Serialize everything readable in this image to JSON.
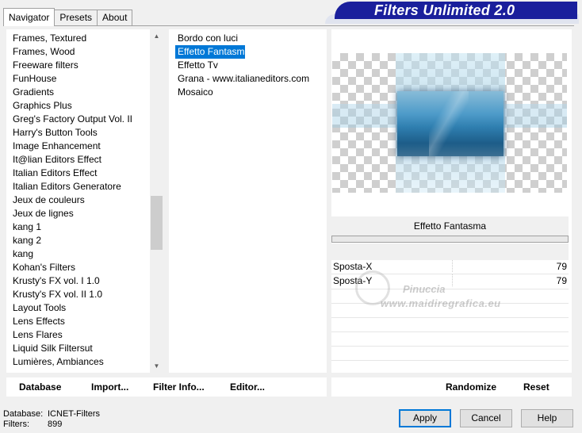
{
  "tabs": [
    "Navigator",
    "Presets",
    "About"
  ],
  "banner": "Filters Unlimited 2.0",
  "categories": [
    "Frames, Textured",
    "Frames, Wood",
    "Freeware filters",
    "FunHouse",
    "Gradients",
    "Graphics Plus",
    "Greg's Factory Output Vol. II",
    "Harry's Button Tools",
    "Image Enhancement",
    "It@lian Editors Effect",
    "Italian Editors Effect",
    "Italian Editors Generatore",
    "Jeux de couleurs",
    "Jeux de lignes",
    "kang 1",
    "kang 2",
    "kang",
    "Kohan's Filters",
    "Krusty's FX vol. I 1.0",
    "Krusty's FX vol. II 1.0",
    "Layout Tools",
    "Lens Effects",
    "Lens Flares",
    "Liquid Silk Filtersut",
    "Lumières, Ambiances"
  ],
  "filters": [
    "Bordo con luci",
    "Effetto Fantasma",
    "Effetto Tv",
    "Grana - www.italianeditors.com",
    "Mosaico"
  ],
  "selected_filter_index": 1,
  "params": {
    "title": "Effetto Fantasma",
    "items": [
      {
        "name": "Sposta-X",
        "value": "79"
      },
      {
        "name": "Sposta-Y",
        "value": "79"
      }
    ]
  },
  "watermark": {
    "name": "Pinuccia",
    "url": "www.maidiregrafica.eu"
  },
  "strip_buttons": {
    "database": "Database",
    "import": "Import...",
    "filter_info": "Filter Info...",
    "editor": "Editor...",
    "randomize": "Randomize",
    "reset": "Reset"
  },
  "footer": {
    "database_label": "Database:",
    "database_value": "ICNET-Filters",
    "filters_label": "Filters:",
    "filters_value": "899"
  },
  "buttons": {
    "apply": "Apply",
    "cancel": "Cancel",
    "help": "Help"
  },
  "colors": {
    "banner": "#1a1f9c",
    "selection": "#0078d7"
  }
}
